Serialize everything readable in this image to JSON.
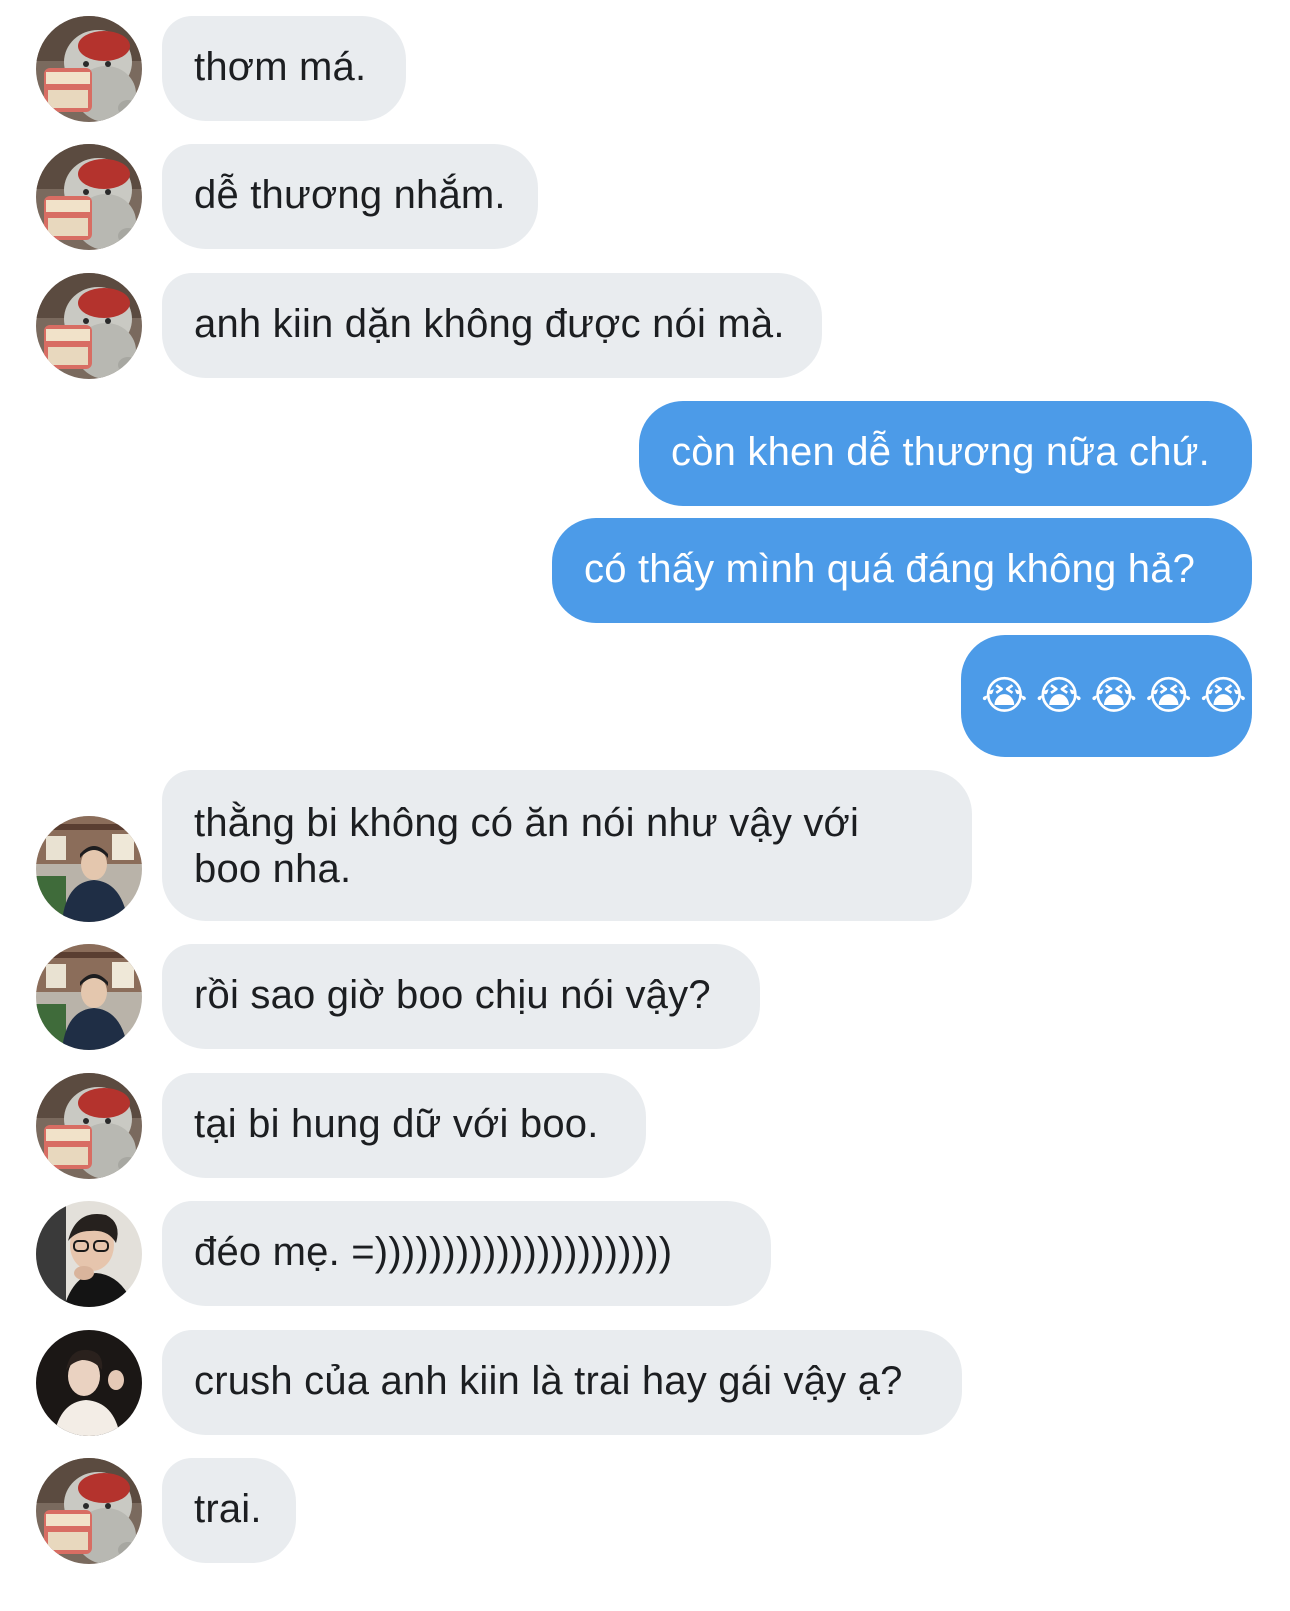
{
  "conversation": {
    "messages": [
      {
        "sender": "bear",
        "text": "thơm má."
      },
      {
        "sender": "bear",
        "text": "dễ thương nhắm."
      },
      {
        "sender": "bear",
        "text": "anh kiin dặn không được nói mà."
      },
      {
        "sender": "me",
        "text": "còn khen dễ thương nữa chứ."
      },
      {
        "sender": "me",
        "text": "có thấy mình quá đáng không hả?"
      },
      {
        "sender": "me",
        "text": "😭😭😭😭😭"
      },
      {
        "sender": "coat",
        "text": "thằng bi không có ăn nói như vậy với boo nha."
      },
      {
        "sender": "coat",
        "text": "rồi sao giờ boo chịu nói vậy?"
      },
      {
        "sender": "bear",
        "text": "tại bi hung dữ với boo."
      },
      {
        "sender": "glasses",
        "text": "đéo mẹ. =))))))))))))))))))))))"
      },
      {
        "sender": "dark",
        "text": "crush của anh kiin là trai hay gái vậy ạ?"
      },
      {
        "sender": "bear",
        "text": "trai."
      }
    ]
  },
  "theme": {
    "incoming_bubble": "#e9ecef",
    "outgoing_bubble": "#4c9be8",
    "incoming_text": "#1c1e21",
    "outgoing_text": "#ffffff"
  },
  "avatars": {
    "bear": "bear-illustration-avatar",
    "coat": "person-in-coat-avatar",
    "glasses": "person-with-glasses-avatar",
    "dark": "person-dark-background-avatar"
  }
}
